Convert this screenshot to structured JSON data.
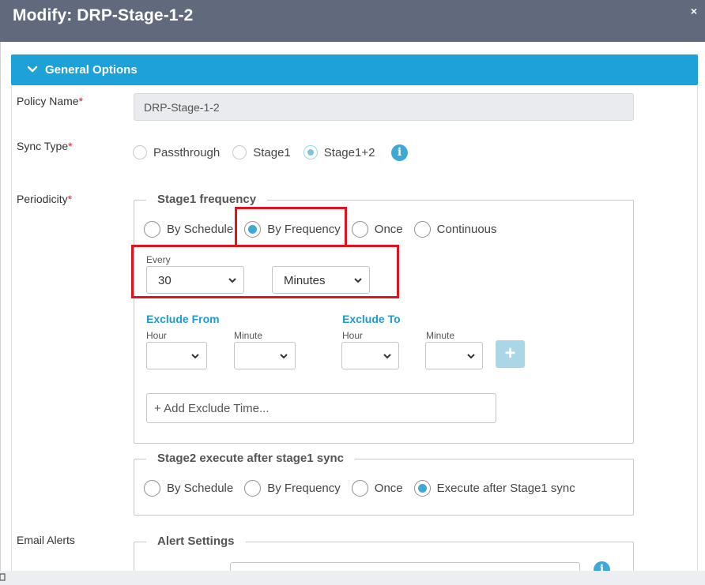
{
  "modal": {
    "title": "Modify: DRP-Stage-1-2",
    "close_symbol": "×"
  },
  "section": {
    "title": "General Options",
    "icon": "chevron-down-icon"
  },
  "policy_name": {
    "label": "Policy Name",
    "required": "*",
    "value": "DRP-Stage-1-2"
  },
  "sync_type": {
    "label": "Sync Type",
    "required": "*",
    "options": [
      {
        "label": "Passthrough",
        "checked": false
      },
      {
        "label": "Stage1",
        "checked": false
      },
      {
        "label": "Stage1+2",
        "checked": true
      }
    ],
    "info_symbol": "i"
  },
  "periodicity": {
    "label": "Periodicity",
    "required": "*"
  },
  "stage1": {
    "legend": "Stage1 frequency",
    "options": [
      {
        "label": "By Schedule",
        "checked": false
      },
      {
        "label": "By Frequency",
        "checked": true
      },
      {
        "label": "Once",
        "checked": false
      },
      {
        "label": "Continuous",
        "checked": false
      }
    ],
    "every_label": "Every",
    "every_value": "30",
    "unit_value": "Minutes",
    "exclude_from": {
      "title": "Exclude From",
      "hour_label": "Hour",
      "minute_label": "Minute"
    },
    "exclude_to": {
      "title": "Exclude To",
      "hour_label": "Hour",
      "minute_label": "Minute"
    },
    "add_symbol": "+",
    "add_exclude_placeholder": "+ Add Exclude Time..."
  },
  "stage2": {
    "legend": "Stage2 execute after stage1 sync",
    "options": [
      {
        "label": "By Schedule",
        "checked": false
      },
      {
        "label": "By Frequency",
        "checked": false
      },
      {
        "label": "Once",
        "checked": false
      },
      {
        "label": "Execute after Stage1 sync",
        "checked": true
      }
    ]
  },
  "email_alerts": {
    "label": "Email Alerts",
    "legend": "Alert Settings",
    "info_symbol": "i"
  },
  "colors": {
    "header": "#606a7c",
    "accent": "#1ea1d6",
    "required": "#d9232d",
    "highlight": "#e0141e"
  }
}
